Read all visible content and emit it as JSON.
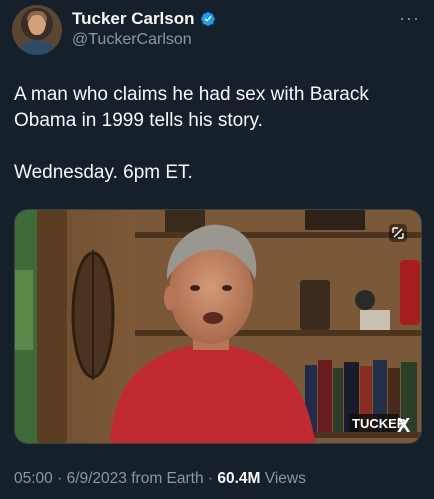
{
  "author": {
    "name": "Tucker Carlson",
    "handle": "@TuckerCarlson",
    "verified_color": "#1d9bf0"
  },
  "tweet": {
    "lines": [
      "A man who claims he had sex with Barack Obama in 1999 tells his story.",
      "Wednesday. 6pm ET."
    ]
  },
  "media": {
    "watermark_logo": "TUCKER",
    "watermark_x": "X"
  },
  "meta": {
    "time": "05:00",
    "date": "6/9/2023",
    "source": "from Earth",
    "views_count": "60.4M",
    "views_label": "Views"
  },
  "icons": {
    "more": "more-icon",
    "verified": "verified-badge-icon",
    "media_expand": "media-expand-icon"
  }
}
